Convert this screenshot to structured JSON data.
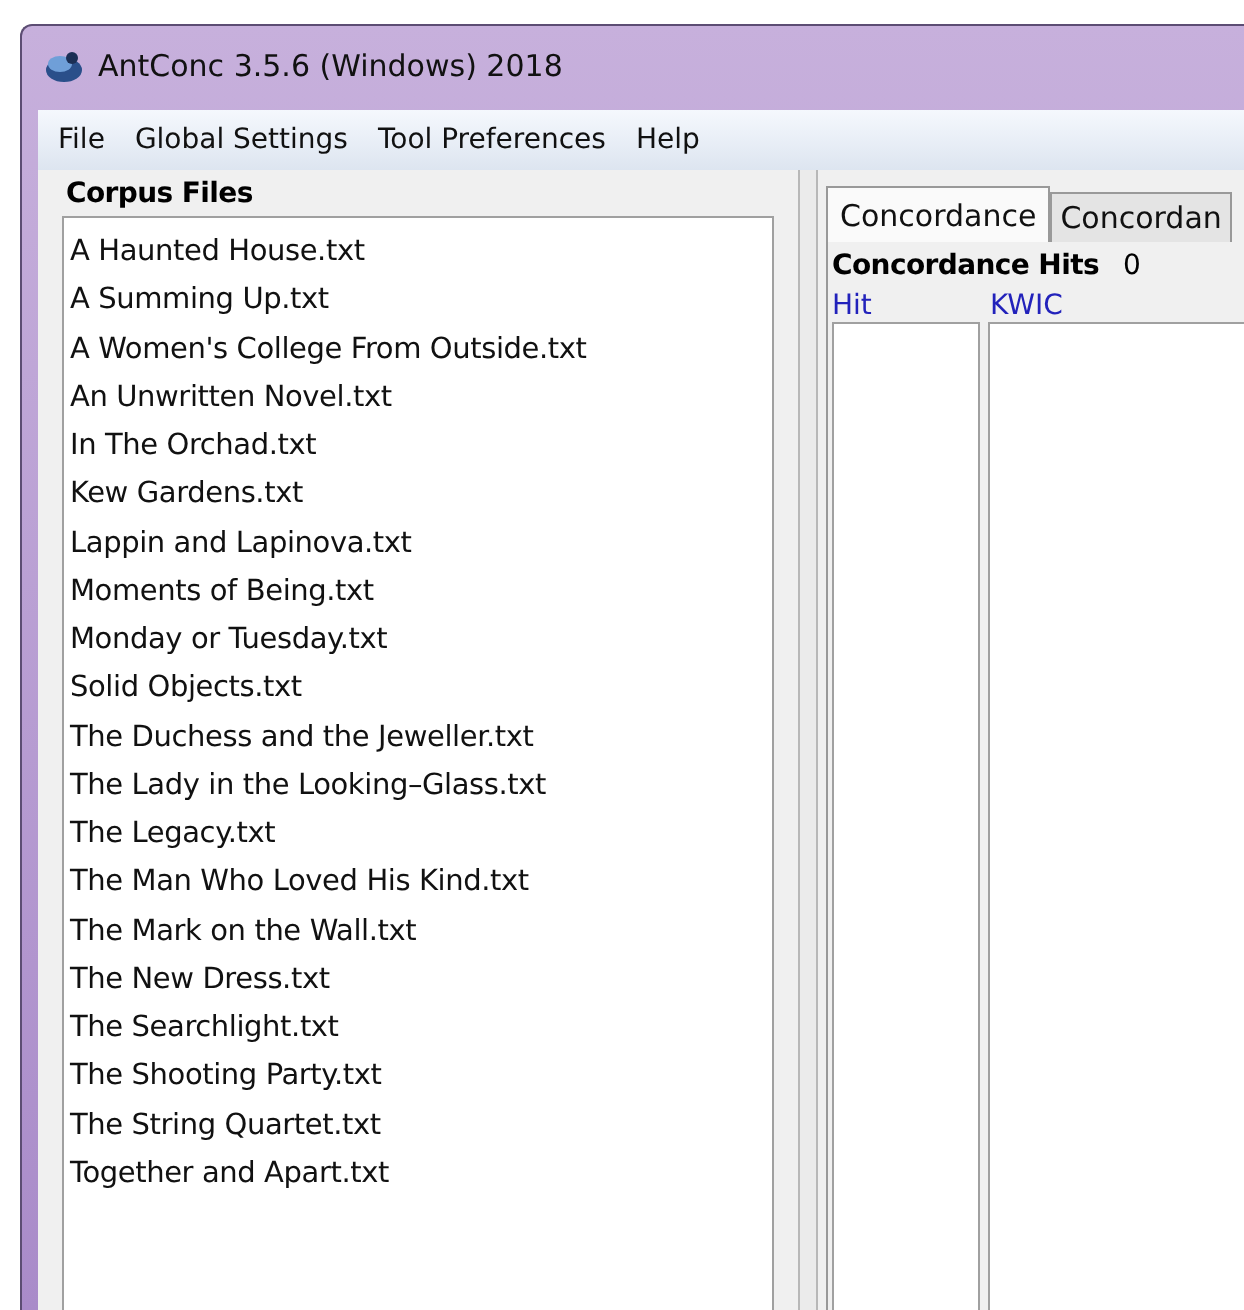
{
  "window": {
    "title": "AntConc 3.5.6 (Windows) 2018"
  },
  "menu": [
    "File",
    "Global Settings",
    "Tool Preferences",
    "Help"
  ],
  "corpus": {
    "title": "Corpus Files",
    "files": [
      {
        "name": "A Haunted House.txt",
        "selected": false
      },
      {
        "name": "A Summing Up.txt",
        "selected": false
      },
      {
        "name": "A Women's College From Outside.txt",
        "selected": false
      },
      {
        "name": "An Unwritten Novel.txt",
        "selected": false
      },
      {
        "name": "In The Orchad.txt",
        "selected": false
      },
      {
        "name": "Kew Gardens.txt",
        "selected": false
      },
      {
        "name": "Lappin and Lapinova.txt",
        "selected": false
      },
      {
        "name": "Moments of Being.txt",
        "selected": false
      },
      {
        "name": "Monday or Tuesday.txt",
        "selected": false
      },
      {
        "name": "Solid Objects.txt",
        "selected": false
      },
      {
        "name": "The Duchess and the Jeweller.txt",
        "selected": false
      },
      {
        "name": "The Lady in the Looking–Glass.txt",
        "selected": false
      },
      {
        "name": "The Legacy.txt",
        "selected": false
      },
      {
        "name": "The Man Who Loved His Kind.txt",
        "selected": false
      },
      {
        "name": "The Mark on the Wall.txt",
        "selected": false
      },
      {
        "name": "The New Dress.txt",
        "selected": false
      },
      {
        "name": "The Searchlight.txt",
        "selected": false
      },
      {
        "name": "The Shooting Party.txt",
        "selected": false
      },
      {
        "name": "The String Quartet.txt",
        "selected": false
      },
      {
        "name": "Together and Apart.txt",
        "selected": false
      }
    ]
  },
  "tabs": [
    {
      "label": "Concordance",
      "selected": true
    },
    {
      "label": "Concordan",
      "selected": false
    }
  ],
  "hits": {
    "label": "Concordance Hits",
    "value": "0"
  },
  "columns": [
    "Hit",
    "KWIC"
  ]
}
